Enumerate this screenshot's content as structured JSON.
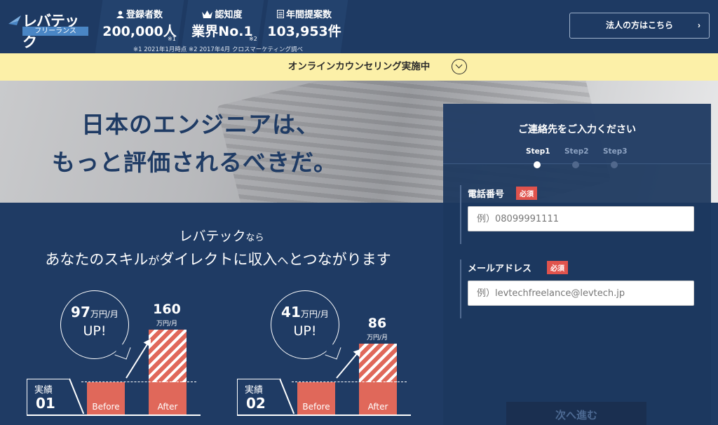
{
  "header": {
    "logo_main": "レバテック",
    "logo_sub": "フリーランス",
    "stats": [
      {
        "label": "登録者数",
        "value": "200,000人",
        "note": "※1",
        "icon": "person-icon"
      },
      {
        "label": "認知度",
        "value": "業界No.1",
        "note": "※2",
        "icon": "crown-icon"
      },
      {
        "label": "年間提案数",
        "value": "103,953件",
        "note": "",
        "icon": "document-icon"
      }
    ],
    "footnote": "※1 2021年1月時点 ※2 2017年4月 クロスマーケティング調べ",
    "corp_button": "法人の方はこちら"
  },
  "banner": {
    "text": "オンラインカウンセリング実施中",
    "icon": "chevron-down-circle-icon"
  },
  "hero": {
    "title_line1": "日本のエンジニアは、",
    "title_line2": "もっと評価されるべきだ。"
  },
  "tagline": {
    "line1_main": "レバテック",
    "line1_small": "なら",
    "line2_a": "あなたのスキル",
    "line2_b": "が",
    "line2_c": "ダイレクトに収入",
    "line2_d": "へ",
    "line2_e": "とつながります"
  },
  "cases": [
    {
      "result_label": "実績",
      "result_num": "01",
      "increase_value": "97",
      "increase_unit": "万円/月",
      "up_text": "UP!",
      "after_value": "160",
      "after_unit": "万円/月",
      "before_label": "Before",
      "after_label": "After"
    },
    {
      "result_label": "実績",
      "result_num": "02",
      "increase_value": "41",
      "increase_unit": "万円/月",
      "up_text": "UP!",
      "after_value": "86",
      "after_unit": "万円/月",
      "before_label": "Before",
      "after_label": "After"
    }
  ],
  "form": {
    "title": "ご連絡先をご入力ください",
    "steps": [
      "Step1",
      "Step2",
      "Step3"
    ],
    "active_step": 1,
    "phone_label": "電話番号",
    "phone_placeholder": "例）08099991111",
    "email_label": "メールアドレス",
    "email_placeholder": "例）levtechfreelance@levtech.jp",
    "required_badge": "必須",
    "next_button": "次へ進む"
  },
  "colors": {
    "navy": "#1f3b64",
    "banner_yellow": "#fcf0a8",
    "accent_red": "#e0685a",
    "required_red": "#e0534d"
  }
}
